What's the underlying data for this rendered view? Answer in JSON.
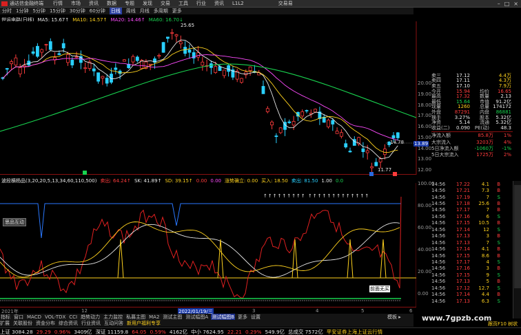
{
  "menubar": {
    "app_title": "通达信金融终端",
    "items": [
      "行情",
      "市场",
      "资讯",
      "数据",
      "专题",
      "发现",
      "交易",
      "工具",
      "行业",
      "资讯",
      "L1L2"
    ],
    "trade_label": "交易",
    "trade_badge": "交易易"
  },
  "periodbar": {
    "items": [
      "分时",
      "1分钟",
      "5分钟",
      "15分钟",
      "30分钟",
      "60分钟",
      "日线",
      "周线",
      "月线",
      "多周期",
      "更多"
    ],
    "active": "日线"
  },
  "main_chart": {
    "title": "世运电路(日线)",
    "ma": [
      {
        "label": "MA5: 15.67↑",
        "color": "#e8e8e8"
      },
      {
        "label": "MA10: 14.57↑",
        "color": "#ffd21e"
      },
      {
        "label": "MA20: 14.46↑",
        "color": "#ff4cff"
      },
      {
        "label": "MA60: 16.70↓",
        "color": "#19d34f"
      }
    ],
    "high_marker": "25.65",
    "low_marker": "11.77",
    "current_marker": "14.78",
    "price_tag": "13.89",
    "y_labels": [
      "20.00",
      "19.00",
      "18.00",
      "17.00",
      "16.00",
      "15.00",
      "14.00",
      "13.00",
      "12.00"
    ]
  },
  "indicator": {
    "title": "波段横杨品(3,20,20,5,13,34,60,110,500)",
    "values": [
      {
        "label": "卖出: 64.24↑",
        "color": "#ff3c3c"
      },
      {
        "label": "SK: 41.89↑",
        "color": "#e8e8e8"
      },
      {
        "label": "SD: 39.15↑",
        "color": "#ffd21e"
      },
      {
        "label": "0.00",
        "color": "#ff3c3c"
      },
      {
        "label": "0.00",
        "color": "#ff4cff"
      },
      {
        "label": "涨势确立: 0.00",
        "color": "#ffd21e"
      },
      {
        "label": "买入: 18.50",
        "color": "#ffd21e"
      },
      {
        "label": "卖出: 81.50",
        "color": "#2ad0ff"
      },
      {
        "label": "1.00",
        "color": "#e8e8e8"
      },
      {
        "label": "0.0",
        "color": "#19d34f"
      }
    ],
    "y_labels": [
      "100.00",
      "80.00",
      "60.00",
      "40.00",
      "20.00",
      "0.00"
    ],
    "buy_marks": "↑↑↑↑↑↑↑↑↑ ↑↑↑↑↑↑↑↑↑↑↑↑↑",
    "bottom_tag": "前面无买",
    "annot_label": "思品互动"
  },
  "timeaxis": {
    "labels": [
      "2021年",
      "12",
      "2022/01/19/三",
      "3",
      "4",
      "5",
      "6"
    ]
  },
  "quote": {
    "rows": [
      {
        "l": "卖三",
        "v": "17.12",
        "vc": "#e8e8e8",
        "v2": "4.4万",
        "v2c": "#ffd21e"
      },
      {
        "l": "卖四",
        "v": "17.11",
        "vc": "#e8e8e8",
        "v2": "4.3万",
        "v2c": "#ffd21e"
      },
      {
        "l": "卖五",
        "v": "17.10",
        "vc": "#e8e8e8",
        "v2": "7.9万",
        "v2c": "#ffd21e"
      },
      {
        "l": "今开",
        "v": "15.94",
        "vc": "#ff3c3c",
        "l2": "均价",
        "v2": "16.65",
        "v2c": "#ff3c3c"
      },
      {
        "l": "最高",
        "v": "17.32",
        "vc": "#ff3c3c",
        "l2": "数量",
        "v2": "2.13",
        "v2c": "#e8e8e8"
      },
      {
        "l": "最低",
        "v": "15.64",
        "vc": "#19d34f",
        "l2": "市值",
        "v2": "91.2亿",
        "v2c": "#e8e8e8"
      },
      {
        "l": "现量",
        "v": "1260",
        "vc": "#ffd21e",
        "l2": "总量",
        "v2": "174172",
        "v2c": "#e8e8e8"
      },
      {
        "l": "外盘",
        "v": "87291",
        "vc": "#ff3c3c",
        "l2": "内盘",
        "v2": "86881",
        "v2c": "#19d34f"
      },
      {
        "l": "换手",
        "v": "3.27%",
        "vc": "#e8e8e8",
        "l2": "股本",
        "v2": "5.32亿",
        "v2c": "#e8e8e8"
      },
      {
        "l": "净资",
        "v": "5.14",
        "vc": "#e8e8e8",
        "l2": "流通",
        "v2": "5.32亿",
        "v2c": "#e8e8e8"
      },
      {
        "l": "收益(二)",
        "v": "0.090",
        "vc": "#e8e8e8",
        "l2": "PE(动)",
        "v2": "48.3",
        "v2c": "#e8e8e8"
      }
    ],
    "flows": [
      {
        "l": "净流入额",
        "v": "85.8万",
        "vc": "#ff3c3c",
        "p": "1%",
        "pc": "#ff3c3c"
      },
      {
        "l": "大宗流入",
        "v": "3203万",
        "vc": "#ff3c3c",
        "p": "4%",
        "pc": "#ff3c3c"
      },
      {
        "l": "5日净流入额",
        "v": "-1060万",
        "vc": "#19d34f",
        "p": "-1%",
        "pc": "#19d34f"
      },
      {
        "l": "5日大宗流入",
        "v": "1725万",
        "vc": "#ff3c3c",
        "p": "2%",
        "pc": "#ff3c3c"
      }
    ]
  },
  "trades": [
    {
      "t": "14:56",
      "p": "17.22",
      "v": "4.1",
      "s": "B"
    },
    {
      "t": "14:56",
      "p": "17.21",
      "v": "7.3",
      "s": "B"
    },
    {
      "t": "14:56",
      "p": "17.19",
      "v": "7",
      "s": "S"
    },
    {
      "t": "14:56",
      "p": "17.18",
      "v": "25.6",
      "s": "B"
    },
    {
      "t": "14:56",
      "p": "17.17",
      "v": "7",
      "s": "B"
    },
    {
      "t": "14:56",
      "p": "17.16",
      "v": "6",
      "s": "S"
    },
    {
      "t": "14:56",
      "p": "17.15",
      "v": "10.5",
      "s": "B"
    },
    {
      "t": "14:56",
      "p": "17.14",
      "v": "12",
      "s": "S"
    },
    {
      "t": "14:56",
      "p": "17.13",
      "v": "3",
      "s": "B"
    },
    {
      "t": "14:56",
      "p": "17.13",
      "v": "7",
      "s": "S"
    },
    {
      "t": "14:56",
      "p": "17.14",
      "v": "4.1",
      "s": "B"
    },
    {
      "t": "14:56",
      "p": "17.15",
      "v": "8.6",
      "s": "B"
    },
    {
      "t": "14:56",
      "p": "17.17",
      "v": "4",
      "s": "S"
    },
    {
      "t": "14:56",
      "p": "17.16",
      "v": "3",
      "s": "B"
    },
    {
      "t": "14:56",
      "p": "17.15",
      "v": "9",
      "s": "S"
    },
    {
      "t": "14:56",
      "p": "17.13",
      "v": "5",
      "s": "B"
    },
    {
      "t": "14:56",
      "p": "17.12",
      "v": "12.7",
      "s": "S"
    },
    {
      "t": "14:56",
      "p": "17.14",
      "v": "4.4",
      "s": "B"
    },
    {
      "t": "14:56",
      "p": "17.13",
      "v": "6.3",
      "s": "S"
    }
  ],
  "tabbar": {
    "items": [
      "指标",
      "窗口",
      "MACD",
      "VOL-TDX",
      "CCI",
      "趋势动力",
      "主力监控",
      "私募主图",
      "MA2",
      "测试主图",
      "测试幅图A",
      "测试幅图B",
      "更多",
      "设置"
    ],
    "active": "测试幅图B",
    "row2": [
      "扩展",
      "关联股份",
      "资金分布",
      "综合资讯",
      "行业资讯",
      "互动问答",
      "新用户福利专享"
    ]
  },
  "statusbar": {
    "items": [
      {
        "text": "上证 3084.28",
        "c": "#e8e8e8"
      },
      {
        "text": "29.29",
        "c": "#ff3c3c"
      },
      {
        "text": "0.96%",
        "c": "#ff3c3c"
      },
      {
        "text": "3409亿",
        "c": "#e8e8e8"
      },
      {
        "text": "深证 11159.8",
        "c": "#e8e8e8"
      },
      {
        "text": "64.05",
        "c": "#ff3c3c"
      },
      {
        "text": "0.59%",
        "c": "#ff3c3c"
      },
      {
        "text": "4162亿",
        "c": "#e8e8e8"
      },
      {
        "text": "中小 7624.95",
        "c": "#e8e8e8"
      },
      {
        "text": "22.21",
        "c": "#ff3c3c"
      },
      {
        "text": "0.29%",
        "c": "#ff3c3c"
      },
      {
        "text": "549.9亿",
        "c": "#e8e8e8"
      },
      {
        "text": "总成交 7572亿",
        "c": "#e8e8e8"
      },
      {
        "text": "平安证券上海上证云行情",
        "c": "#ffd21e"
      }
    ],
    "right_link": "跟页F10 树状",
    "watermark": "www.7gpzb.com"
  }
}
